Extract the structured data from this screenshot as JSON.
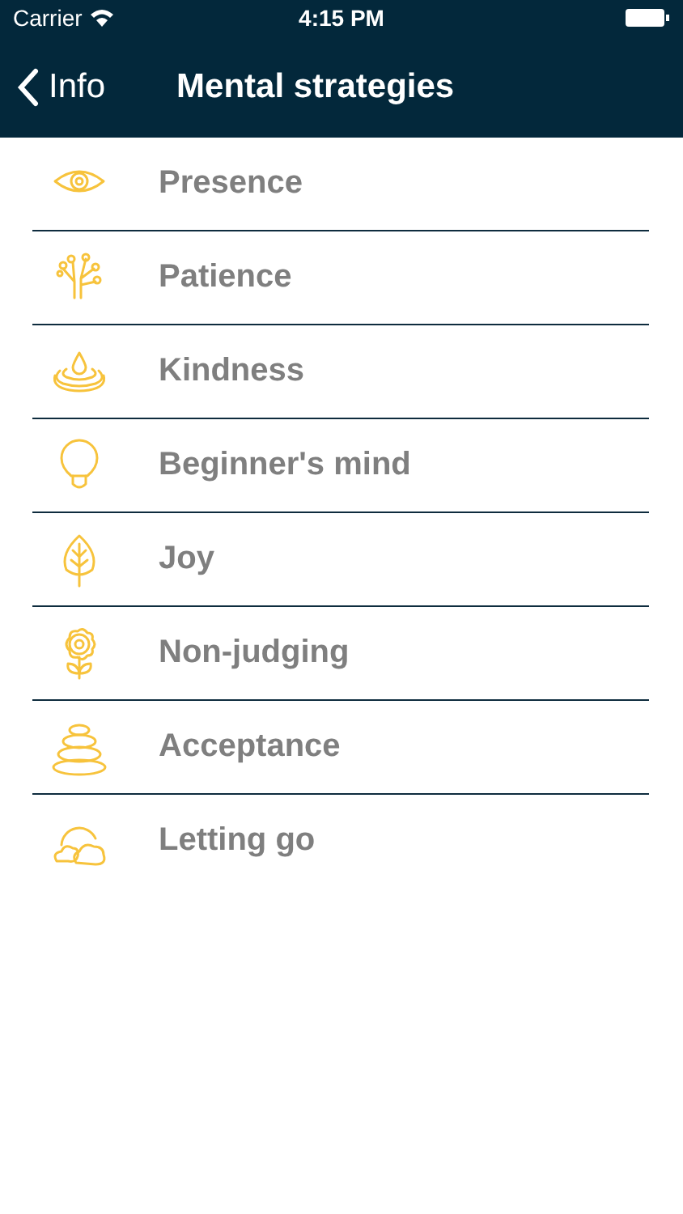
{
  "status_bar": {
    "carrier": "Carrier",
    "time": "4:15 PM"
  },
  "nav_bar": {
    "back": "Info",
    "title": "Mental strategies"
  },
  "items": [
    {
      "label": "Presence",
      "kind": "eye"
    },
    {
      "label": "Patience",
      "kind": "tree"
    },
    {
      "label": "Kindness",
      "kind": "drop"
    },
    {
      "label": "Beginner's mind",
      "kind": "bulb"
    },
    {
      "label": "Joy",
      "kind": "leaf"
    },
    {
      "label": "Non-judging",
      "kind": "flower"
    },
    {
      "label": "Acceptance",
      "kind": "stones"
    },
    {
      "label": "Letting go",
      "kind": "clouds"
    }
  ]
}
